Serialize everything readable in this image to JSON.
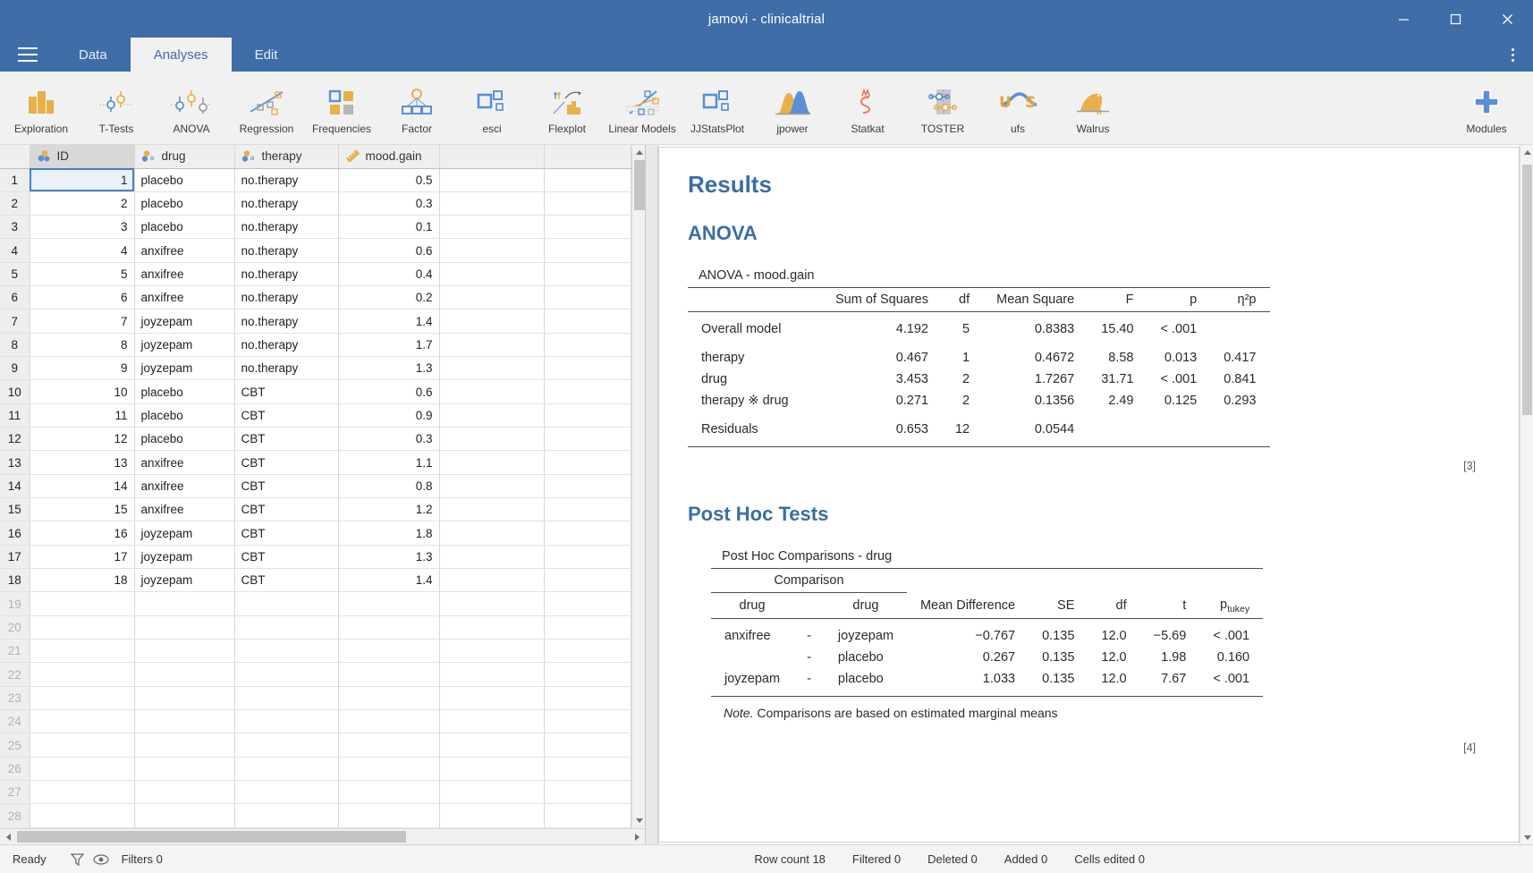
{
  "window": {
    "title": "jamovi - clinicaltrial",
    "minimize_label": "Minimize",
    "maximize_label": "Maximize",
    "close_label": "Close"
  },
  "tabs": {
    "menu_icon": "hamburger-icon",
    "items": [
      {
        "label": "Data",
        "active": false
      },
      {
        "label": "Analyses",
        "active": true
      },
      {
        "label": "Edit",
        "active": false
      }
    ],
    "overflow_icon": "kebab-menu-icon"
  },
  "ribbon": {
    "items": [
      {
        "label": "Exploration",
        "icon": "bar-chart-icon"
      },
      {
        "label": "T-Tests",
        "icon": "t-test-icon"
      },
      {
        "label": "ANOVA",
        "icon": "anova-icon"
      },
      {
        "label": "Regression",
        "icon": "regression-icon"
      },
      {
        "label": "Frequencies",
        "icon": "frequencies-icon"
      },
      {
        "label": "Factor",
        "icon": "factor-icon"
      },
      {
        "label": "esci",
        "icon": "esci-icon"
      },
      {
        "label": "Flexplot",
        "icon": "flexplot-icon"
      },
      {
        "label": "Linear Models",
        "icon": "linear-models-icon"
      },
      {
        "label": "JJStatsPlot",
        "icon": "jjstatsplot-icon"
      },
      {
        "label": "jpower",
        "icon": "jpower-icon"
      },
      {
        "label": "Statkat",
        "icon": "statkat-icon"
      },
      {
        "label": "TOSTER",
        "icon": "toster-icon"
      },
      {
        "label": "ufs",
        "icon": "ufs-icon"
      },
      {
        "label": "Walrus",
        "icon": "walrus-icon"
      }
    ],
    "modules": {
      "label": "Modules",
      "icon": "plus-icon"
    }
  },
  "spreadsheet": {
    "columns": [
      {
        "name": "ID",
        "type": "nominal-id-icon"
      },
      {
        "name": "drug",
        "type": "nominal-text-icon"
      },
      {
        "name": "therapy",
        "type": "nominal-text-icon"
      },
      {
        "name": "mood.gain",
        "type": "continuous-icon"
      }
    ],
    "selected_cell": {
      "row": 1,
      "column": "ID"
    },
    "rows": [
      {
        "n": "1",
        "ID": "1",
        "drug": "placebo",
        "therapy": "no.therapy",
        "mood_gain": "0.5"
      },
      {
        "n": "2",
        "ID": "2",
        "drug": "placebo",
        "therapy": "no.therapy",
        "mood_gain": "0.3"
      },
      {
        "n": "3",
        "ID": "3",
        "drug": "placebo",
        "therapy": "no.therapy",
        "mood_gain": "0.1"
      },
      {
        "n": "4",
        "ID": "4",
        "drug": "anxifree",
        "therapy": "no.therapy",
        "mood_gain": "0.6"
      },
      {
        "n": "5",
        "ID": "5",
        "drug": "anxifree",
        "therapy": "no.therapy",
        "mood_gain": "0.4"
      },
      {
        "n": "6",
        "ID": "6",
        "drug": "anxifree",
        "therapy": "no.therapy",
        "mood_gain": "0.2"
      },
      {
        "n": "7",
        "ID": "7",
        "drug": "joyzepam",
        "therapy": "no.therapy",
        "mood_gain": "1.4"
      },
      {
        "n": "8",
        "ID": "8",
        "drug": "joyzepam",
        "therapy": "no.therapy",
        "mood_gain": "1.7"
      },
      {
        "n": "9",
        "ID": "9",
        "drug": "joyzepam",
        "therapy": "no.therapy",
        "mood_gain": "1.3"
      },
      {
        "n": "10",
        "ID": "10",
        "drug": "placebo",
        "therapy": "CBT",
        "mood_gain": "0.6"
      },
      {
        "n": "11",
        "ID": "11",
        "drug": "placebo",
        "therapy": "CBT",
        "mood_gain": "0.9"
      },
      {
        "n": "12",
        "ID": "12",
        "drug": "placebo",
        "therapy": "CBT",
        "mood_gain": "0.3"
      },
      {
        "n": "13",
        "ID": "13",
        "drug": "anxifree",
        "therapy": "CBT",
        "mood_gain": "1.1"
      },
      {
        "n": "14",
        "ID": "14",
        "drug": "anxifree",
        "therapy": "CBT",
        "mood_gain": "0.8"
      },
      {
        "n": "15",
        "ID": "15",
        "drug": "anxifree",
        "therapy": "CBT",
        "mood_gain": "1.2"
      },
      {
        "n": "16",
        "ID": "16",
        "drug": "joyzepam",
        "therapy": "CBT",
        "mood_gain": "1.8"
      },
      {
        "n": "17",
        "ID": "17",
        "drug": "joyzepam",
        "therapy": "CBT",
        "mood_gain": "1.3"
      },
      {
        "n": "18",
        "ID": "18",
        "drug": "joyzepam",
        "therapy": "CBT",
        "mood_gain": "1.4"
      }
    ],
    "empty_row_numbers": [
      "19",
      "20",
      "21",
      "22",
      "23",
      "24",
      "25",
      "26",
      "27",
      "28"
    ]
  },
  "results": {
    "heading": "Results",
    "anova": {
      "heading": "ANOVA",
      "table_title": "ANOVA - mood.gain",
      "columns": [
        "",
        "Sum of Squares",
        "df",
        "Mean Square",
        "F",
        "p",
        "η²p"
      ],
      "rows": [
        {
          "name": "Overall model",
          "ss": "4.192",
          "df": "5",
          "ms": "0.8383",
          "F": "15.40",
          "p": "< .001",
          "eta": ""
        },
        {
          "name": "therapy",
          "ss": "0.467",
          "df": "1",
          "ms": "0.4672",
          "F": "8.58",
          "p": "0.013",
          "eta": "0.417"
        },
        {
          "name": "drug",
          "ss": "3.453",
          "df": "2",
          "ms": "1.7267",
          "F": "31.71",
          "p": "< .001",
          "eta": "0.841"
        },
        {
          "name": "therapy ※ drug",
          "ss": "0.271",
          "df": "2",
          "ms": "0.1356",
          "F": "2.49",
          "p": "0.125",
          "eta": "0.293"
        },
        {
          "name": "Residuals",
          "ss": "0.653",
          "df": "12",
          "ms": "0.0544",
          "F": "",
          "p": "",
          "eta": ""
        }
      ],
      "ref_mark": "[3]"
    },
    "posthoc": {
      "heading": "Post Hoc Tests",
      "table_title": "Post Hoc Comparisons - drug",
      "group_header": "Comparison",
      "columns": [
        "drug",
        "drug",
        "Mean Difference",
        "SE",
        "df",
        "t",
        "p"
      ],
      "p_subscript": "tukey",
      "rows": [
        {
          "a": "anxifree",
          "dash": "-",
          "b": "joyzepam",
          "md": "−0.767",
          "se": "0.135",
          "df": "12.0",
          "t": "−5.69",
          "ptukey": "< .001"
        },
        {
          "a": "",
          "dash": "-",
          "b": "placebo",
          "md": "0.267",
          "se": "0.135",
          "df": "12.0",
          "t": "1.98",
          "ptukey": "0.160"
        },
        {
          "a": "joyzepam",
          "dash": "-",
          "b": "placebo",
          "md": "1.033",
          "se": "0.135",
          "df": "12.0",
          "t": "7.67",
          "ptukey": "< .001"
        }
      ],
      "note_label": "Note.",
      "note_text": " Comparisons are based on estimated marginal means",
      "ref_mark": "[4]"
    }
  },
  "statusbar": {
    "status": "Ready",
    "filter_icon": "funnel-icon",
    "eye_icon": "eye-icon",
    "filters": "Filters 0",
    "row_count": "Row count 18",
    "filtered": "Filtered 0",
    "deleted": "Deleted 0",
    "added": "Added 0",
    "cells_edited": "Cells edited 0"
  },
  "colors": {
    "titlebar": "#3e6da8",
    "accent_blue": "#3a6ea5",
    "ribbon_bg": "#f1f1f1",
    "icon_orange": "#e8b04b",
    "icon_blue": "#5b8fd4"
  }
}
